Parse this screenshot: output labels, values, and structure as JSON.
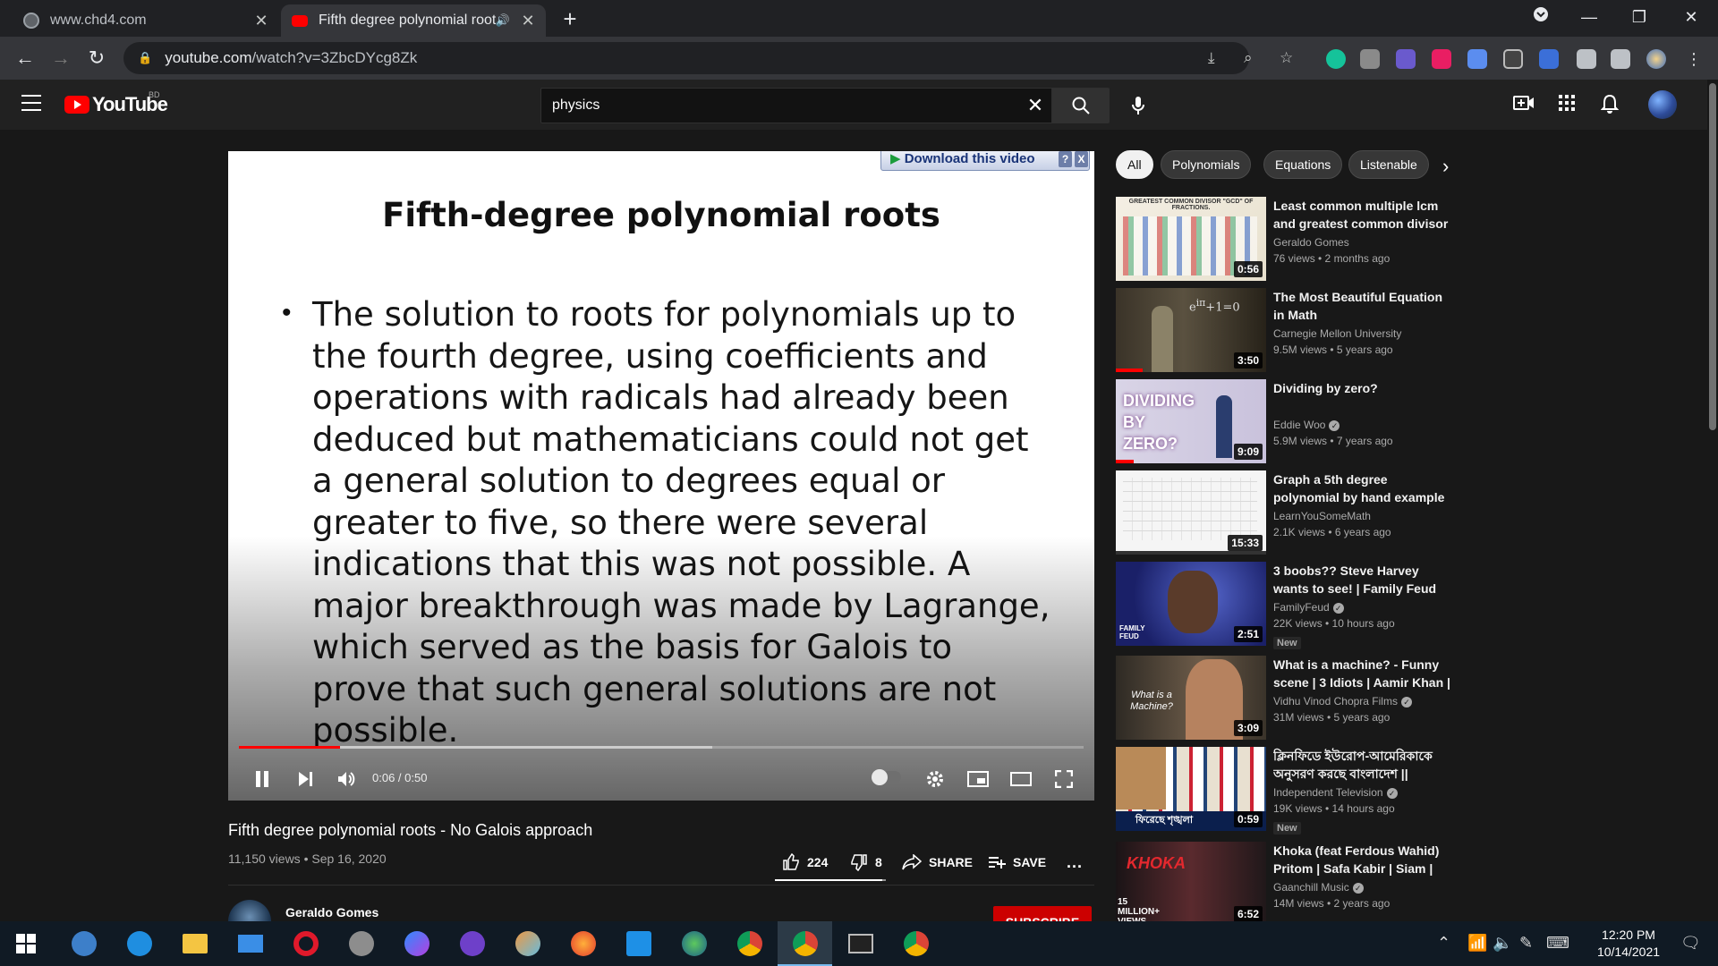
{
  "browser": {
    "tabs": [
      {
        "title": "www.chd4.com",
        "active": false
      },
      {
        "title": "Fifth degree polynomial roots - No Galois approach - YouTube",
        "active": true,
        "audio": true
      }
    ],
    "url_domain": "youtube.com",
    "url_path": "/watch?v=3ZbcDYcg8Zk"
  },
  "youtube": {
    "logo_text": "YouTube",
    "country_code": "BD",
    "search_value": "physics",
    "search_placeholder": "Search"
  },
  "player": {
    "download_bar": "Download this video",
    "download_help": "?",
    "download_close": "X",
    "slide_title": "Fifth-degree polynomial roots",
    "slide_bullet": "•",
    "slide_text": "The solution to roots  for polynomials up to the fourth degree, using coefficients and operations with radicals had already been deduced but mathematicians could not get a general solution to degrees equal or greater to five, so there were several indications that this was not possible.  A major breakthrough was made by Lagrange, which served as the basis for Galois to prove that such general solutions are not possible.",
    "current_time": "0:06",
    "duration": "0:50",
    "time_text": "0:06 / 0:50",
    "played_fraction": 0.12,
    "buffered_fraction": 0.56
  },
  "video": {
    "title": "Fifth degree polynomial roots - No Galois approach",
    "meta": "11,150 views • Sep 16, 2020",
    "likes": "224",
    "dislikes": "8",
    "like_ratio": 0.97,
    "share_label": "SHARE",
    "save_label": "SAVE",
    "more_label": "...",
    "channel": "Geraldo Gomes",
    "subscribe_label": "SUBSCRIBE"
  },
  "chips": [
    "All",
    "Polynomials",
    "Equations",
    "Listenable"
  ],
  "recommendations": [
    {
      "title": "Least common multiple lcm and greatest common divisor gcd",
      "channel": "Geraldo Gomes",
      "verified": false,
      "meta": "76 views • 2 months ago",
      "duration": "0:56",
      "badge": "",
      "thumb_text": "GREATEST COMMON DIVISOR \"GCD\" OF FRACTIONS."
    },
    {
      "title": "The Most Beautiful Equation in Math",
      "channel": "Carnegie Mellon University",
      "verified": false,
      "meta": "9.5M views • 5 years ago",
      "duration": "3:50",
      "badge": "",
      "thumb_text": ""
    },
    {
      "title": "Dividing by zero?",
      "channel": "Eddie Woo",
      "verified": true,
      "meta": "5.9M views • 7 years ago",
      "duration": "9:09",
      "badge": "",
      "thumb_text": "DIVIDING BY ZERO?"
    },
    {
      "title": "Graph a 5th degree polynomial by hand example",
      "channel": "LearnYouSomeMath",
      "verified": false,
      "meta": "2.1K views • 6 years ago",
      "duration": "15:33",
      "badge": "",
      "thumb_text": ""
    },
    {
      "title": "3 boobs?? Steve Harvey wants to see! | Family Feud",
      "channel": "FamilyFeud",
      "verified": true,
      "meta": "22K views • 10 hours ago",
      "duration": "2:51",
      "badge": "New",
      "thumb_text": "FAMILY FEUD"
    },
    {
      "title": "What is a machine? - Funny scene | 3 Idiots | Aamir Khan | Boman Irani",
      "channel": "Vidhu Vinod Chopra Films",
      "verified": true,
      "meta": "31M views • 5 years ago",
      "duration": "3:09",
      "badge": "",
      "thumb_text": "What is a Machine?"
    },
    {
      "title": "ক্লিনফিডে ইউরোপ-আমেরিকাকে অনুসরণ করছে বাংলাদেশ || Independent TV",
      "channel": "Independent Television",
      "verified": true,
      "meta": "19K views • 14 hours ago",
      "duration": "0:59",
      "badge": "New",
      "thumb_text": "ফিরেছে শৃঙ্খলা"
    },
    {
      "title": "Khoka (feat Ferdous Wahid) Pritom | Safa Kabir | Siam | Bangla Song",
      "channel": "Gaanchill Music",
      "verified": true,
      "meta": "14M views • 2 years ago",
      "duration": "6:52",
      "badge": "",
      "thumb_text": "15 MILLION+ VIEWS"
    }
  ],
  "taskbar": {
    "time": "12:20 PM",
    "date": "10/14/2021"
  },
  "colors": {
    "youtube_red": "#ff0000",
    "subscribe": "#cc0000",
    "taskbar": "#101a24"
  }
}
